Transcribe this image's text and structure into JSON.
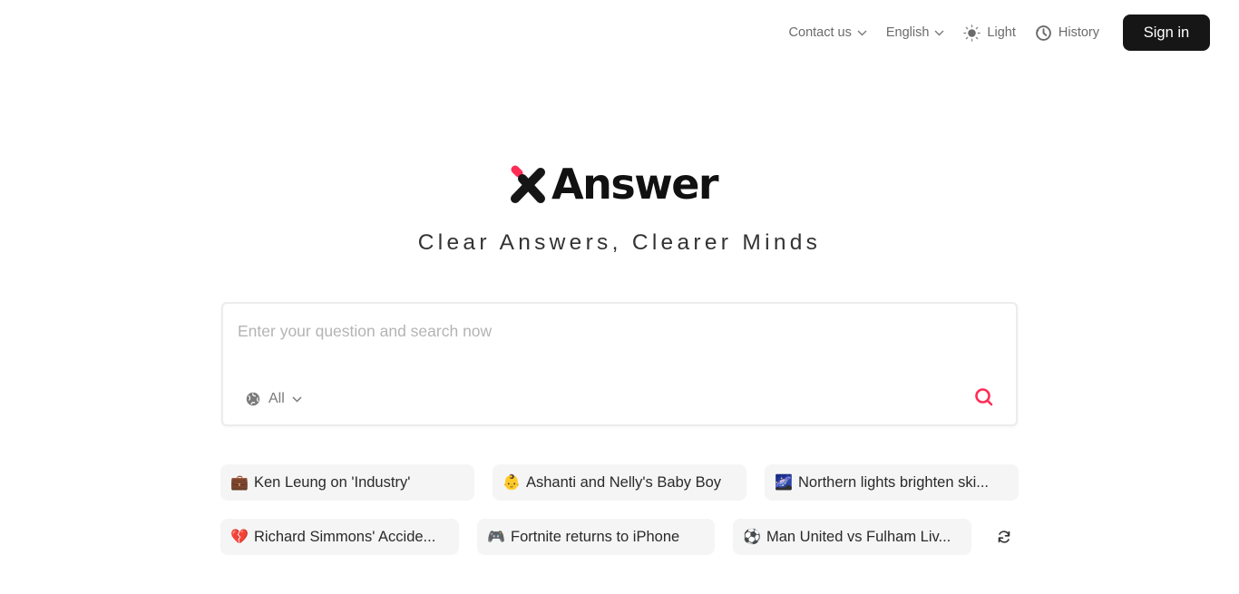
{
  "header": {
    "contact_label": "Contact us",
    "language_label": "English",
    "theme_label": "Light",
    "history_label": "History",
    "signin_label": "Sign in"
  },
  "brand": {
    "name": "Answer",
    "tagline": "Clear Answers, Clearer Minds",
    "accent_color": "#ff2d55",
    "dark_color": "#161616"
  },
  "search": {
    "placeholder": "Enter your question and search now",
    "value": "",
    "scope_label": "All",
    "scope_icon": "globe-icon",
    "submit_icon": "search-icon"
  },
  "suggestions": [
    {
      "emoji": "💼",
      "icon": "briefcase-icon",
      "label": "Ken Leung on 'Industry'"
    },
    {
      "emoji": "👶",
      "icon": "baby-icon",
      "label": "Ashanti and Nelly's Baby Boy"
    },
    {
      "emoji": "🌌",
      "icon": "night-sky-icon",
      "label": "Northern lights brighten ski..."
    },
    {
      "emoji": "💔",
      "icon": "broken-heart-icon",
      "label": "Richard Simmons' Accide..."
    },
    {
      "emoji": "🎮",
      "icon": "game-controller-icon",
      "label": "Fortnite returns to iPhone"
    },
    {
      "emoji": "⚽",
      "icon": "soccer-ball-icon",
      "label": "Man United vs Fulham Liv..."
    }
  ],
  "refresh_icon": "refresh-icon"
}
